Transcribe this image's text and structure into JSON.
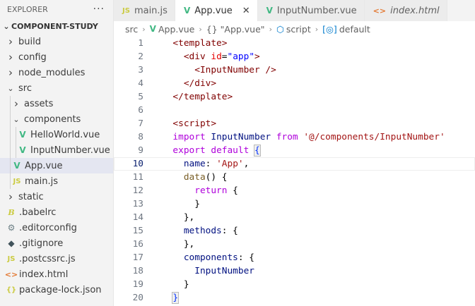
{
  "explorer": {
    "title": "EXPLORER",
    "more": "···",
    "root": "COMPONENT-STUDY",
    "items": [
      {
        "label": "build",
        "type": "folder",
        "depth": 0,
        "expanded": false,
        "icon": "chevron-right-icon"
      },
      {
        "label": "config",
        "type": "folder",
        "depth": 0,
        "expanded": false,
        "icon": "chevron-right-icon"
      },
      {
        "label": "node_modules",
        "type": "folder",
        "depth": 0,
        "expanded": false,
        "icon": "chevron-right-icon"
      },
      {
        "label": "src",
        "type": "folder",
        "depth": 0,
        "expanded": true,
        "icon": "chevron-down-icon"
      },
      {
        "label": "assets",
        "type": "folder",
        "depth": 1,
        "expanded": false,
        "icon": "chevron-right-icon"
      },
      {
        "label": "components",
        "type": "folder",
        "depth": 1,
        "expanded": true,
        "icon": "chevron-down-icon"
      },
      {
        "label": "HelloWorld.vue",
        "type": "vue",
        "depth": 2,
        "icon": "vue-icon"
      },
      {
        "label": "InputNumber.vue",
        "type": "vue",
        "depth": 2,
        "icon": "vue-icon"
      },
      {
        "label": "App.vue",
        "type": "vue",
        "depth": 1,
        "selected": true,
        "icon": "vue-icon"
      },
      {
        "label": "main.js",
        "type": "js",
        "depth": 1,
        "icon": "js-icon"
      },
      {
        "label": "static",
        "type": "folder",
        "depth": 0,
        "expanded": false,
        "icon": "chevron-right-icon"
      },
      {
        "label": ".babelrc",
        "type": "babel",
        "depth": 0,
        "icon": "babel-icon"
      },
      {
        "label": ".editorconfig",
        "type": "gear",
        "depth": 0,
        "icon": "gear-icon"
      },
      {
        "label": ".gitignore",
        "type": "git",
        "depth": 0,
        "icon": "git-icon"
      },
      {
        "label": ".postcssrc.js",
        "type": "js",
        "depth": 0,
        "icon": "js-icon"
      },
      {
        "label": "index.html",
        "type": "html",
        "depth": 0,
        "icon": "html-icon"
      },
      {
        "label": "package-lock.json",
        "type": "json",
        "depth": 0,
        "icon": "json-icon"
      }
    ]
  },
  "tabs": [
    {
      "label": "main.js",
      "icon": "js-icon",
      "active": false,
      "italic": false
    },
    {
      "label": "App.vue",
      "icon": "vue-icon",
      "active": true,
      "italic": false,
      "close": "✕"
    },
    {
      "label": "InputNumber.vue",
      "icon": "vue-icon",
      "active": false,
      "italic": false
    },
    {
      "label": "index.html",
      "icon": "html-icon",
      "active": false,
      "italic": true
    }
  ],
  "breadcrumb": {
    "parts": [
      "src",
      "App.vue",
      "{} \"App.vue\"",
      "script",
      "default"
    ]
  },
  "editor": {
    "current_line": 10,
    "lines": [
      {
        "n": "1",
        "tokens": [
          [
            "  ",
            "pl"
          ],
          [
            "<template>",
            "tag"
          ]
        ]
      },
      {
        "n": "2",
        "tokens": [
          [
            "    ",
            "pl"
          ],
          [
            "<div ",
            "tag"
          ],
          [
            "id",
            "attr"
          ],
          [
            "=",
            "pl"
          ],
          [
            "\"app\"",
            "str"
          ],
          [
            ">",
            "tag"
          ]
        ]
      },
      {
        "n": "3",
        "tokens": [
          [
            "      ",
            "pl"
          ],
          [
            "<InputNumber />",
            "tag"
          ]
        ]
      },
      {
        "n": "4",
        "tokens": [
          [
            "    ",
            "pl"
          ],
          [
            "</div>",
            "tag"
          ]
        ]
      },
      {
        "n": "5",
        "tokens": [
          [
            "  ",
            "pl"
          ],
          [
            "</template>",
            "tag"
          ]
        ]
      },
      {
        "n": "6",
        "tokens": []
      },
      {
        "n": "7",
        "tokens": [
          [
            "  ",
            "pl"
          ],
          [
            "<script>",
            "tag"
          ]
        ]
      },
      {
        "n": "8",
        "tokens": [
          [
            "  ",
            "pl"
          ],
          [
            "import ",
            "ctl"
          ],
          [
            "InputNumber ",
            "prop"
          ],
          [
            "from ",
            "ctl"
          ],
          [
            "'@/components/InputNumber'",
            "sstr"
          ]
        ]
      },
      {
        "n": "9",
        "tokens": [
          [
            "  ",
            "pl"
          ],
          [
            "export ",
            "ctl"
          ],
          [
            "default ",
            "ctl"
          ],
          [
            "{",
            "brh"
          ]
        ]
      },
      {
        "n": "10",
        "tokens": [
          [
            "    ",
            "pl"
          ],
          [
            "name",
            "prop"
          ],
          [
            ": ",
            "pl"
          ],
          [
            "'App'",
            "sstr"
          ],
          [
            ",",
            "pl"
          ]
        ]
      },
      {
        "n": "11",
        "tokens": [
          [
            "    ",
            "pl"
          ],
          [
            "data",
            "fn"
          ],
          [
            "() {",
            "pl"
          ]
        ]
      },
      {
        "n": "12",
        "tokens": [
          [
            "      ",
            "pl"
          ],
          [
            "return ",
            "ctl"
          ],
          [
            "{",
            "pl"
          ]
        ]
      },
      {
        "n": "13",
        "tokens": [
          [
            "      ",
            "pl"
          ],
          [
            "}",
            "pl"
          ]
        ]
      },
      {
        "n": "14",
        "tokens": [
          [
            "    ",
            "pl"
          ],
          [
            "},",
            "pl"
          ]
        ]
      },
      {
        "n": "15",
        "tokens": [
          [
            "    ",
            "pl"
          ],
          [
            "methods",
            "prop"
          ],
          [
            ": {",
            "pl"
          ]
        ]
      },
      {
        "n": "16",
        "tokens": [
          [
            "    ",
            "pl"
          ],
          [
            "},",
            "pl"
          ]
        ]
      },
      {
        "n": "17",
        "tokens": [
          [
            "    ",
            "pl"
          ],
          [
            "components",
            "prop"
          ],
          [
            ": {",
            "pl"
          ]
        ]
      },
      {
        "n": "18",
        "tokens": [
          [
            "      ",
            "pl"
          ],
          [
            "InputNumber",
            "prop"
          ]
        ]
      },
      {
        "n": "19",
        "tokens": [
          [
            "    ",
            "pl"
          ],
          [
            "}",
            "pl"
          ]
        ]
      },
      {
        "n": "20",
        "tokens": [
          [
            "  ",
            "pl"
          ],
          [
            "}",
            "brh"
          ]
        ]
      }
    ]
  },
  "colors": {
    "vue": "#41b883",
    "js": "#cbcb41",
    "html": "#e37933",
    "tag": "#800000",
    "keyword": "#af00db",
    "string": "#a31515"
  }
}
